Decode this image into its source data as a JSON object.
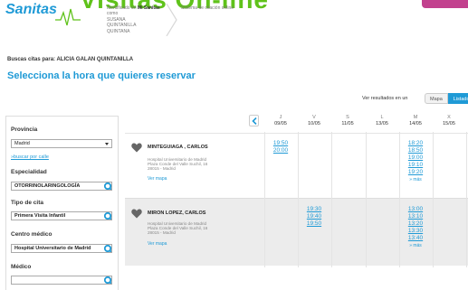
{
  "header": {
    "logo": "Sanitas",
    "title": "Visitas On-line",
    "identified_as_prefix": "Identificado en",
    "identified_site": "Mi Sanitas",
    "identified_as_word": "como",
    "user_name_lines": [
      "SUSANA",
      "QUINTANILLA",
      "QUINTANA"
    ],
    "system_label": "Sistema de citación online",
    "brand_color": "#1f9ad6",
    "title_color": "#5fc21a",
    "accent_button_color": "#c2418e"
  },
  "patient": {
    "label": "Buscas citas para: ALICIA GALAN QUINTANILLA"
  },
  "page_heading": "Selecciona la hora que quieres reservar",
  "view": {
    "label": "Ver resultados en un",
    "map_option": "Mapa",
    "list_option": "Listado",
    "selected": "Listado"
  },
  "filters": {
    "provincia_label": "Provincia",
    "provincia_value": "Madrid",
    "search_by_street": "»buscar por calle",
    "especialidad_label": "Especialidad",
    "especialidad_value": "OTORRINOLARINGOLOGÍA",
    "tipo_label": "Tipo de cita",
    "tipo_value": "Primera Visita Infantil",
    "centro_label": "Centro médico",
    "centro_value": "Hospital Universitario de Madrid",
    "medico_label": "Médico",
    "medico_value": ""
  },
  "days": [
    {
      "weekday": "J",
      "date": "09/05"
    },
    {
      "weekday": "V",
      "date": "10/05"
    },
    {
      "weekday": "S",
      "date": "11/05"
    },
    {
      "weekday": "L",
      "date": "13/05"
    },
    {
      "weekday": "M",
      "date": "14/05"
    },
    {
      "weekday": "X",
      "date": "15/05"
    }
  ],
  "doctors": [
    {
      "name": "MINTEGUIAGA , CARLOS",
      "address_lines": [
        "Hospital Universitario de Madrid",
        "Plaza Conde del Valle Suchil, 16",
        "28015 - Madrid"
      ],
      "map_link": "Ver mapa",
      "slots": [
        [
          "19:50",
          "20:00"
        ],
        [],
        [],
        [],
        [
          "18:20",
          "18:50",
          "19:00",
          "19:10",
          "19:20"
        ],
        []
      ],
      "more": [
        null,
        null,
        null,
        null,
        "» más",
        null
      ]
    },
    {
      "name": "MIRON LOPEZ, CARLOS",
      "address_lines": [
        "Hospital Universitario de Madrid",
        "Plaza Conde del Valle Suchil, 16",
        "28015 - Madrid"
      ],
      "map_link": "Ver mapa",
      "slots": [
        [],
        [
          "19:30",
          "19:40",
          "19:50"
        ],
        [],
        [],
        [
          "13:00",
          "13:10",
          "13:20",
          "13:30",
          "13:40"
        ],
        []
      ],
      "more": [
        null,
        null,
        null,
        null,
        "» más",
        null
      ]
    }
  ]
}
